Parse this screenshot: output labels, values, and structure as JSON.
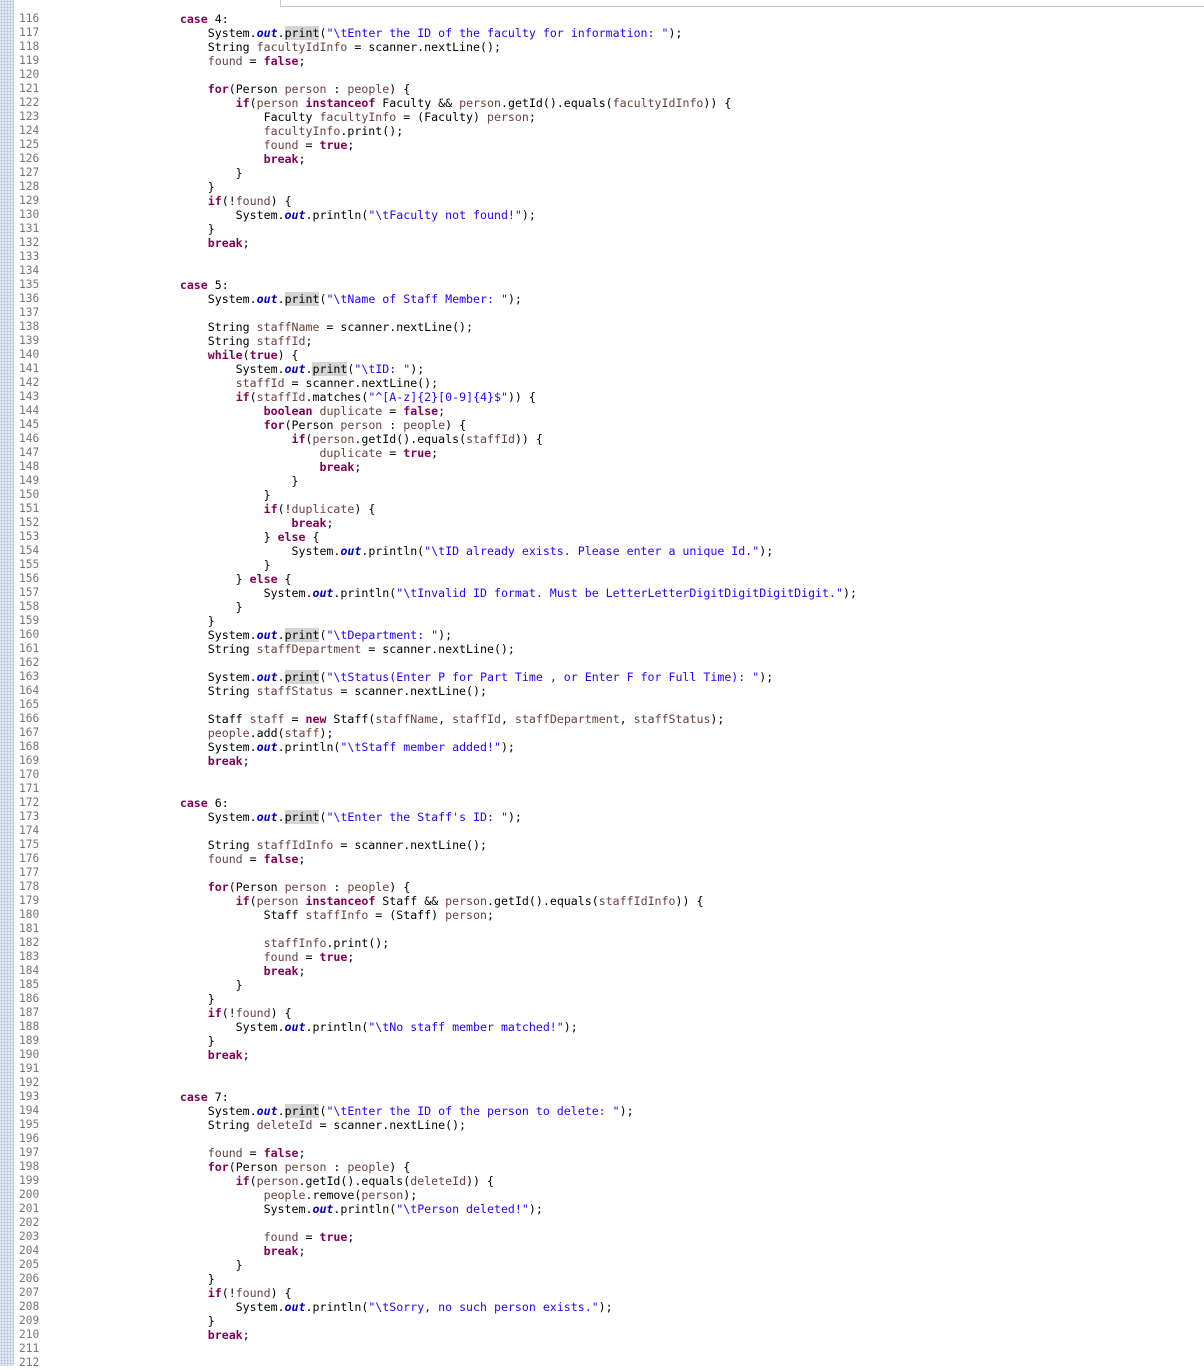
{
  "editor": {
    "lines": [
      {
        "n": "116",
        "t": "        case 4:"
      },
      {
        "n": "117",
        "t": "            System.out.print(\"\\tEnter the ID of the faculty for information: \");"
      },
      {
        "n": "118",
        "t": "            String facultyIdInfo = scanner.nextLine();"
      },
      {
        "n": "119",
        "t": "            found = false;"
      },
      {
        "n": "120",
        "t": ""
      },
      {
        "n": "121",
        "t": "            for(Person person : people) {"
      },
      {
        "n": "122",
        "t": "                if(person instanceof Faculty && person.getId().equals(facultyIdInfo)) {"
      },
      {
        "n": "123",
        "t": "                    Faculty facultyInfo = (Faculty) person;"
      },
      {
        "n": "124",
        "t": "                    facultyInfo.print();"
      },
      {
        "n": "125",
        "t": "                    found = true;"
      },
      {
        "n": "126",
        "t": "                    break;"
      },
      {
        "n": "127",
        "t": "                }"
      },
      {
        "n": "128",
        "t": "            }"
      },
      {
        "n": "129",
        "t": "            if(!found) {"
      },
      {
        "n": "130",
        "t": "                System.out.println(\"\\tFaculty not found!\");"
      },
      {
        "n": "131",
        "t": "            }"
      },
      {
        "n": "132",
        "t": "            break;"
      },
      {
        "n": "133",
        "t": ""
      },
      {
        "n": "134",
        "t": ""
      },
      {
        "n": "135",
        "t": "        case 5:"
      },
      {
        "n": "136",
        "t": "            System.out.print(\"\\tName of Staff Member: \");"
      },
      {
        "n": "137",
        "t": ""
      },
      {
        "n": "138",
        "t": "            String staffName = scanner.nextLine();"
      },
      {
        "n": "139",
        "t": "            String staffId;"
      },
      {
        "n": "140",
        "t": "            while(true) {"
      },
      {
        "n": "141",
        "t": "                System.out.print(\"\\tID: \");"
      },
      {
        "n": "142",
        "t": "                staffId = scanner.nextLine();"
      },
      {
        "n": "143",
        "t": "                if(staffId.matches(\"^[A-z]{2}[0-9]{4}$\")) {"
      },
      {
        "n": "144",
        "t": "                    boolean duplicate = false;"
      },
      {
        "n": "145",
        "t": "                    for(Person person : people) {"
      },
      {
        "n": "146",
        "t": "                        if(person.getId().equals(staffId)) {"
      },
      {
        "n": "147",
        "t": "                            duplicate = true;"
      },
      {
        "n": "148",
        "t": "                            break;"
      },
      {
        "n": "149",
        "t": "                        }"
      },
      {
        "n": "150",
        "t": "                    }"
      },
      {
        "n": "151",
        "t": "                    if(!duplicate) {"
      },
      {
        "n": "152",
        "t": "                        break;"
      },
      {
        "n": "153",
        "t": "                    } else {"
      },
      {
        "n": "154",
        "t": "                        System.out.println(\"\\tID already exists. Please enter a unique Id.\");"
      },
      {
        "n": "155",
        "t": "                    }"
      },
      {
        "n": "156",
        "t": "                } else {"
      },
      {
        "n": "157",
        "t": "                    System.out.println(\"\\tInvalid ID format. Must be LetterLetterDigitDigitDigitDigit.\");"
      },
      {
        "n": "158",
        "t": "                }"
      },
      {
        "n": "159",
        "t": "            }"
      },
      {
        "n": "160",
        "t": "            System.out.print(\"\\tDepartment: \");"
      },
      {
        "n": "161",
        "t": "            String staffDepartment = scanner.nextLine();"
      },
      {
        "n": "162",
        "t": ""
      },
      {
        "n": "163",
        "t": "            System.out.print(\"\\tStatus(Enter P for Part Time , or Enter F for Full Time): \");"
      },
      {
        "n": "164",
        "t": "            String staffStatus = scanner.nextLine();"
      },
      {
        "n": "165",
        "t": ""
      },
      {
        "n": "166",
        "t": "            Staff staff = new Staff(staffName, staffId, staffDepartment, staffStatus);"
      },
      {
        "n": "167",
        "t": "            people.add(staff);"
      },
      {
        "n": "168",
        "t": "            System.out.println(\"\\tStaff member added!\");"
      },
      {
        "n": "169",
        "t": "            break;"
      },
      {
        "n": "170",
        "t": ""
      },
      {
        "n": "171",
        "t": ""
      },
      {
        "n": "172",
        "t": "        case 6:"
      },
      {
        "n": "173",
        "t": "            System.out.print(\"\\tEnter the Staff's ID: \");"
      },
      {
        "n": "174",
        "t": ""
      },
      {
        "n": "175",
        "t": "            String staffIdInfo = scanner.nextLine();"
      },
      {
        "n": "176",
        "t": "            found = false;"
      },
      {
        "n": "177",
        "t": ""
      },
      {
        "n": "178",
        "t": "            for(Person person : people) {"
      },
      {
        "n": "179",
        "t": "                if(person instanceof Staff && person.getId().equals(staffIdInfo)) {"
      },
      {
        "n": "180",
        "t": "                    Staff staffInfo = (Staff) person;"
      },
      {
        "n": "181",
        "t": ""
      },
      {
        "n": "182",
        "t": "                    staffInfo.print();"
      },
      {
        "n": "183",
        "t": "                    found = true;"
      },
      {
        "n": "184",
        "t": "                    break;"
      },
      {
        "n": "185",
        "t": "                }"
      },
      {
        "n": "186",
        "t": "            }"
      },
      {
        "n": "187",
        "t": "            if(!found) {"
      },
      {
        "n": "188",
        "t": "                System.out.println(\"\\tNo staff member matched!\");"
      },
      {
        "n": "189",
        "t": "            }"
      },
      {
        "n": "190",
        "t": "            break;"
      },
      {
        "n": "191",
        "t": ""
      },
      {
        "n": "192",
        "t": ""
      },
      {
        "n": "193",
        "t": "        case 7:"
      },
      {
        "n": "194",
        "t": "            System.out.print(\"\\tEnter the ID of the person to delete: \");"
      },
      {
        "n": "195",
        "t": "            String deleteId = scanner.nextLine();"
      },
      {
        "n": "196",
        "t": ""
      },
      {
        "n": "197",
        "t": "            found = false;"
      },
      {
        "n": "198",
        "t": "            for(Person person : people) {"
      },
      {
        "n": "199",
        "t": "                if(person.getId().equals(deleteId)) {"
      },
      {
        "n": "200",
        "t": "                    people.remove(person);"
      },
      {
        "n": "201",
        "t": "                    System.out.println(\"\\tPerson deleted!\");"
      },
      {
        "n": "202",
        "t": ""
      },
      {
        "n": "203",
        "t": "                    found = true;"
      },
      {
        "n": "204",
        "t": "                    break;"
      },
      {
        "n": "205",
        "t": "                }"
      },
      {
        "n": "206",
        "t": "            }"
      },
      {
        "n": "207",
        "t": "            if(!found) {"
      },
      {
        "n": "208",
        "t": "                System.out.println(\"\\tSorry, no such person exists.\");"
      },
      {
        "n": "209",
        "t": "            }"
      },
      {
        "n": "210",
        "t": "            break;"
      },
      {
        "n": "211",
        "t": ""
      },
      {
        "n": "212",
        "t": ""
      }
    ],
    "colors": {
      "keyword": "#7f0055",
      "string": "#2a00ff",
      "static_field": "#0000c0",
      "variable": "#6a3e3e",
      "line_number": "#767676",
      "occurrence_highlight": "#d4d4d4"
    }
  }
}
